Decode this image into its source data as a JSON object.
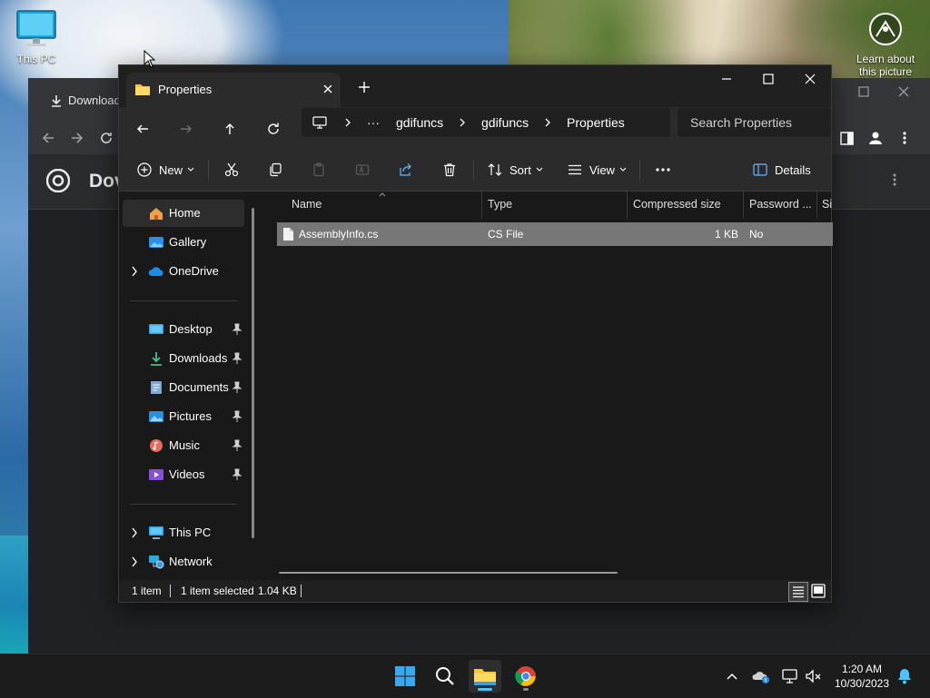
{
  "desktop": {
    "icons": [
      {
        "label": "This PC",
        "icon": "monitor-icon"
      }
    ],
    "spotlight": {
      "label": "Learn about this picture",
      "icon": "spotlight-icon"
    }
  },
  "background_window": {
    "tab_label": "Download",
    "page_title": "Dov"
  },
  "explorer": {
    "tab": {
      "title": "Properties",
      "icon": "folder-icon"
    },
    "window_controls": [
      "minimize",
      "maximize",
      "close"
    ],
    "nav": {
      "back": "back-arrow-icon",
      "forward": "forward-arrow-icon",
      "up": "up-arrow-icon",
      "refresh": "refresh-icon"
    },
    "breadcrumbs": [
      "gdifuncs",
      "gdifuncs",
      "Properties"
    ],
    "overflow_crumb": "···",
    "search": {
      "placeholder": "Search Properties"
    },
    "commands": {
      "new": "New",
      "sort": "Sort",
      "view": "View",
      "details": "Details",
      "more": "···"
    },
    "sidebar": {
      "items": [
        {
          "label": "Home",
          "icon": "home-icon",
          "selected": true
        },
        {
          "label": "Gallery",
          "icon": "gallery-icon"
        },
        {
          "label": "OneDrive",
          "icon": "cloud-icon",
          "expandable": true
        },
        {
          "label": "Desktop",
          "icon": "desktop-icon",
          "pinned": true
        },
        {
          "label": "Downloads",
          "icon": "download-icon",
          "pinned": true
        },
        {
          "label": "Documents",
          "icon": "document-icon",
          "pinned": true
        },
        {
          "label": "Pictures",
          "icon": "pictures-icon",
          "pinned": true
        },
        {
          "label": "Music",
          "icon": "music-icon",
          "pinned": true
        },
        {
          "label": "Videos",
          "icon": "videos-icon",
          "pinned": true
        },
        {
          "label": "This PC",
          "icon": "monitor-icon",
          "expandable": true
        },
        {
          "label": "Network",
          "icon": "network-icon",
          "expandable": true
        }
      ]
    },
    "columns": [
      "Name",
      "Type",
      "Compressed size",
      "Password ...",
      "Si"
    ],
    "files": [
      {
        "name": "AssemblyInfo.cs",
        "type": "CS File",
        "compressed_size": "1 KB",
        "password": "No",
        "selected": true
      }
    ],
    "status": {
      "count": "1 item",
      "selection": "1 item selected",
      "size": "1.04 KB"
    }
  },
  "taskbar": {
    "apps": [
      {
        "name": "start",
        "icon": "windows-logo-icon"
      },
      {
        "name": "search",
        "icon": "search-icon"
      },
      {
        "name": "file-explorer",
        "icon": "folder-icon",
        "active": true
      },
      {
        "name": "chrome",
        "icon": "chrome-icon"
      }
    ],
    "clock": {
      "time": "1:20 AM",
      "date": "10/30/2023"
    },
    "colors": {
      "accent": "#4cc2ff"
    }
  }
}
